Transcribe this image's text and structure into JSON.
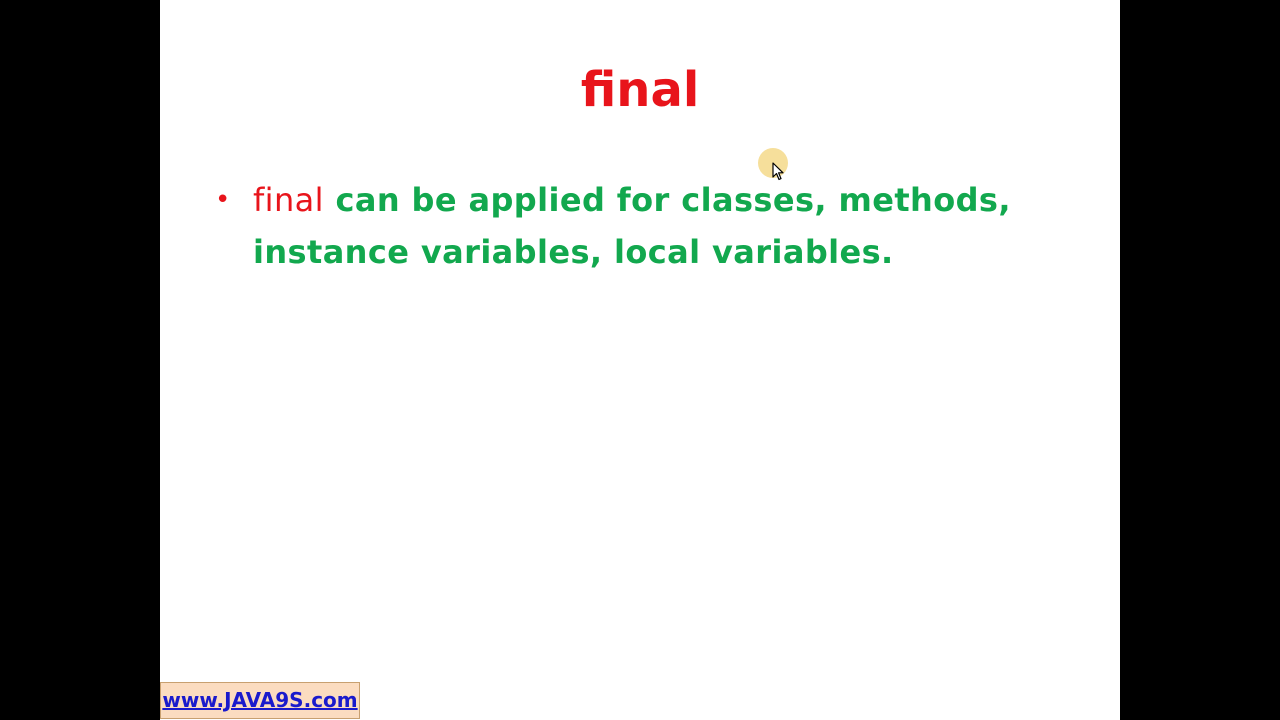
{
  "colors": {
    "title": "#e8141b",
    "keyword": "#e8141b",
    "description": "#12a84e",
    "bullet": "#e8141b",
    "link_text": "#1a1acc",
    "link_background": "#fbdcc0",
    "cursor_halo": "#f5d98a"
  },
  "slide": {
    "title": "final",
    "bullets": [
      {
        "keyword": "final",
        "text": " can be applied for classes, methods, instance variables, local variables."
      }
    ]
  },
  "footer": {
    "link_label": "www.JAVA9S.com"
  },
  "icons": {
    "bullet": "bullet-dot-icon",
    "cursor": "mouse-pointer-icon"
  }
}
